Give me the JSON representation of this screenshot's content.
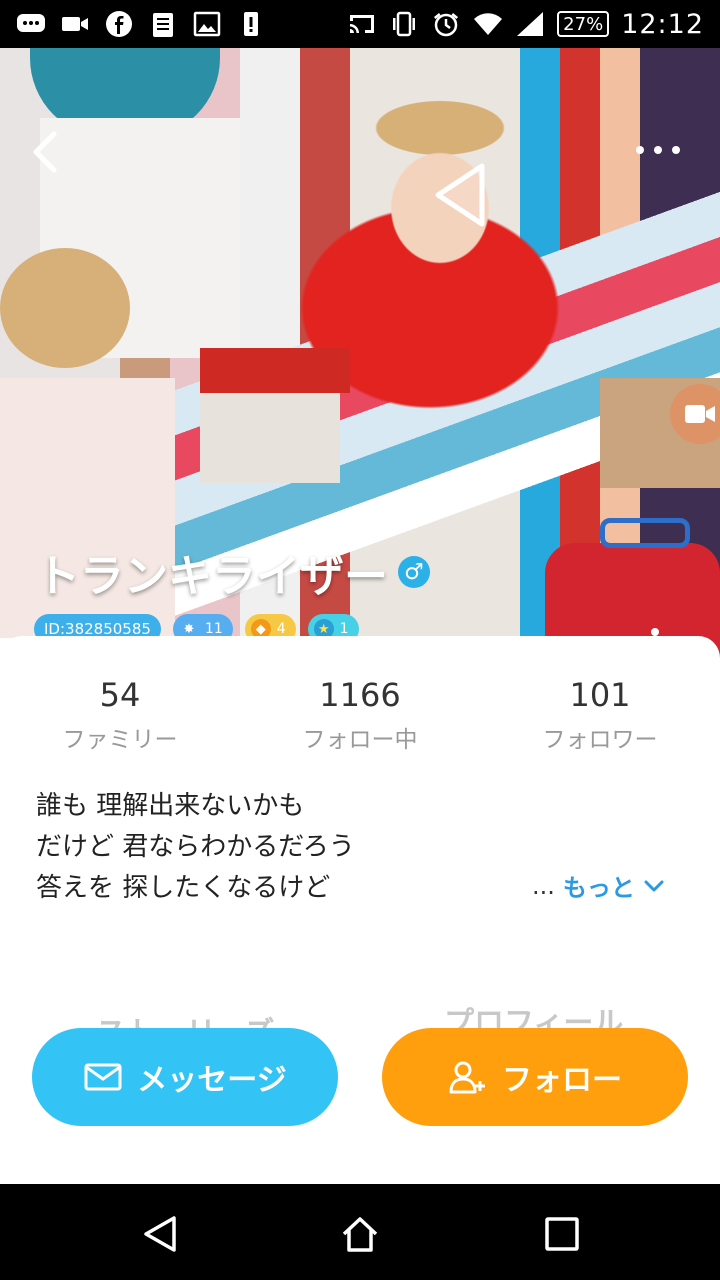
{
  "status_bar": {
    "battery": "27%",
    "time": "12:12",
    "left_icons": [
      "chat-icon",
      "video-camera-icon",
      "facebook-icon",
      "clipboard-icon",
      "image-icon",
      "alert-icon"
    ],
    "right_icons": [
      "cast-icon",
      "vibrate-icon",
      "alarm-icon",
      "wifi-icon",
      "signal-icon"
    ]
  },
  "hero": {
    "name": "トランキライザー",
    "gender_symbol": "♂",
    "badges": {
      "id": "ID:382850585",
      "level": "11",
      "gems": "4",
      "stars": "1"
    }
  },
  "stats": [
    {
      "value": "54",
      "label": "ファミリー"
    },
    {
      "value": "1166",
      "label": "フォロー中"
    },
    {
      "value": "101",
      "label": "フォロワー"
    }
  ],
  "bio": {
    "lines": [
      "誰も 理解出来ないかも",
      "だけど 君ならわかるだろう",
      "答えを 探したくなるけど"
    ],
    "ellipsis": "...",
    "more_label": "もっと"
  },
  "tabs": {
    "stories": "ストーリーズ",
    "profile": "プロフィール"
  },
  "actions": {
    "message": "メッセージ",
    "follow": "フォロー"
  },
  "colors": {
    "accent_blue": "#33c4f5",
    "accent_orange": "#ff9f0d",
    "link_blue": "#2a9ae2"
  }
}
